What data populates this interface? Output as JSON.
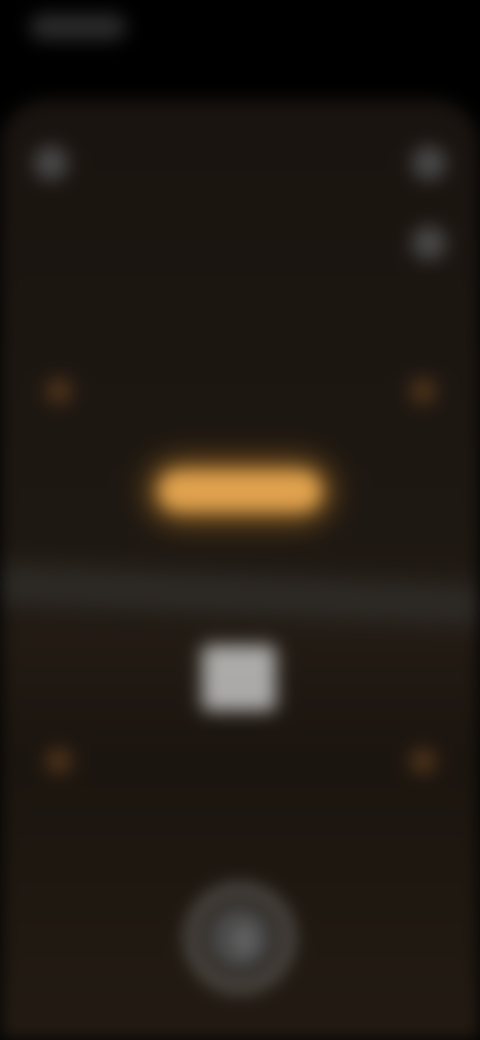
{
  "status_bar": {
    "time": "",
    "pill_label": ""
  },
  "top_controls": [
    {
      "icon": "flash-icon"
    },
    {
      "icon": "settings-icon"
    },
    {
      "icon": "more-icon"
    }
  ],
  "focus_markers": [
    {
      "icon": "focus-corner-icon"
    },
    {
      "icon": "focus-corner-icon"
    },
    {
      "icon": "focus-corner-icon"
    },
    {
      "icon": "focus-corner-icon"
    }
  ],
  "preview": {
    "glow_label": "",
    "highlight_label": ""
  },
  "shutter": {
    "icon": "shutter-icon",
    "label": ""
  },
  "colors": {
    "accent_glow": "#e0a24e",
    "background": "#000000",
    "viewfinder": "#1e1812"
  }
}
